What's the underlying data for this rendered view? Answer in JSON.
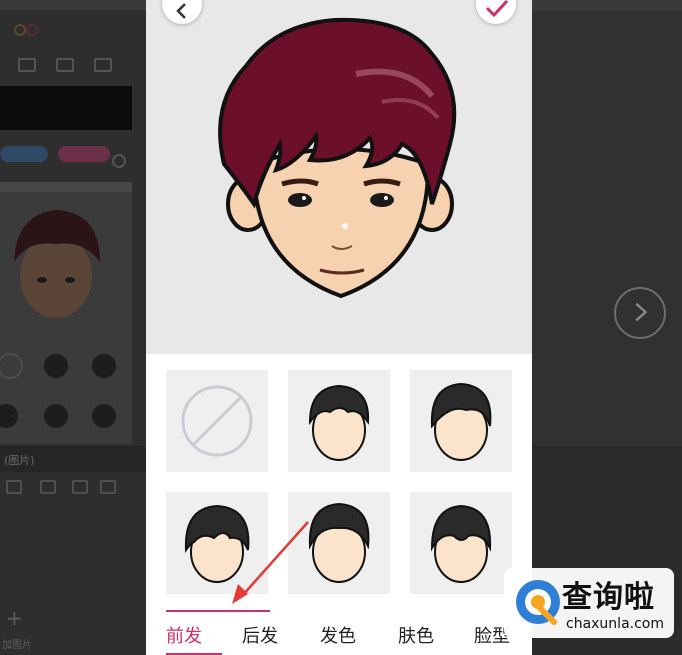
{
  "background_app": {
    "section_label": "(图片)",
    "add_label": "加图片"
  },
  "modal": {
    "back_icon": "chevron-left-icon",
    "confirm_icon": "checkmark-icon"
  },
  "tabs": [
    {
      "label": "前发",
      "active": true
    },
    {
      "label": "后发",
      "active": false
    },
    {
      "label": "发色",
      "active": false
    },
    {
      "label": "肤色",
      "active": false
    },
    {
      "label": "脸型",
      "active": false
    }
  ],
  "hair_options": [
    {
      "name": "none"
    },
    {
      "name": "style-1"
    },
    {
      "name": "style-2"
    },
    {
      "name": "style-3"
    },
    {
      "name": "style-4"
    },
    {
      "name": "style-5"
    }
  ],
  "colors": {
    "accent": "#cf2f6b",
    "hair": "#6b0f2a",
    "skin": "#f6d2b0"
  },
  "watermark": {
    "title": "查询啦",
    "subtitle": "chaxunla.com"
  }
}
